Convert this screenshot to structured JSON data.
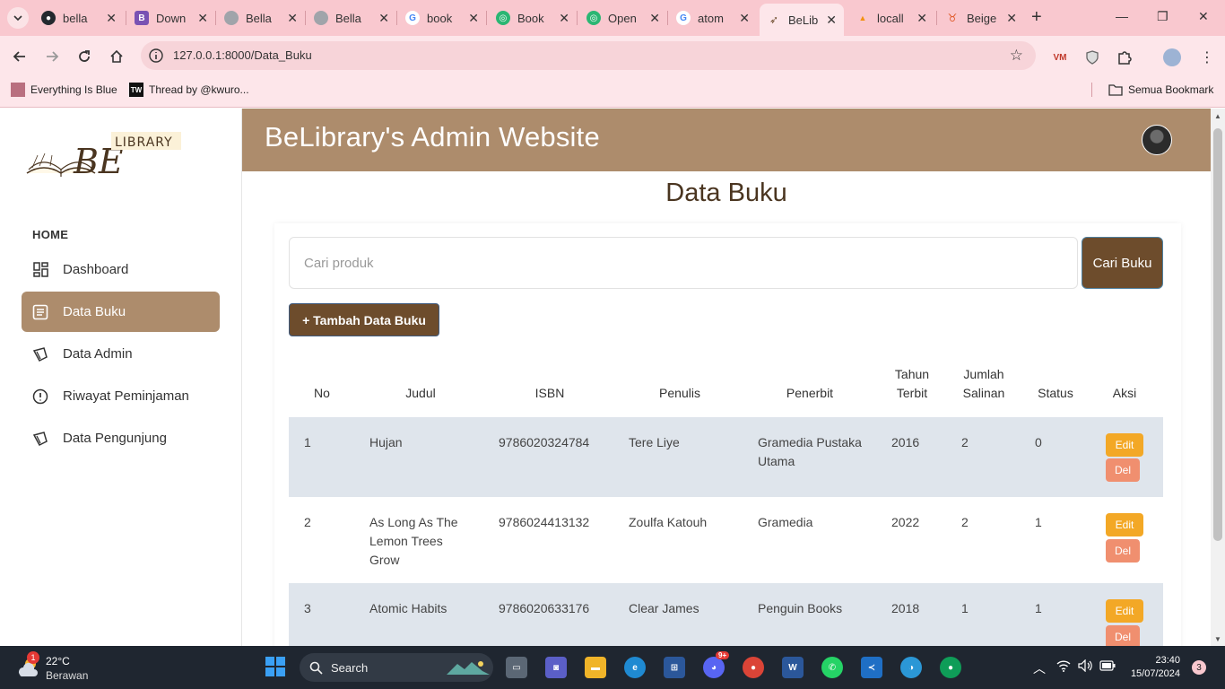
{
  "browser": {
    "tabs": [
      {
        "label": "bella",
        "icon": "github-icon",
        "color": "#333333"
      },
      {
        "label": "Down",
        "icon": "bootstrap-icon",
        "color": "#7952b3"
      },
      {
        "label": "Bella",
        "icon": "globe-icon",
        "color": "#9aa0a6"
      },
      {
        "label": "Bella",
        "icon": "globe-icon",
        "color": "#9aa0a6"
      },
      {
        "label": "book",
        "icon": "google-icon",
        "color": "#4285f4"
      },
      {
        "label": "Book",
        "icon": "openai-icon",
        "color": "#10a37f"
      },
      {
        "label": "Open",
        "icon": "openai-icon",
        "color": "#10a37f"
      },
      {
        "label": "atom",
        "icon": "google-icon",
        "color": "#4285f4"
      },
      {
        "label": "BeLib",
        "icon": "book-icon",
        "color": "#ad8c6c"
      },
      {
        "label": "locall",
        "icon": "phpmyadmin-icon",
        "color": "#f29111"
      },
      {
        "label": "Beige",
        "icon": "tailwind-icon",
        "color": "#f29111"
      }
    ],
    "url": "127.0.0.1:8000/Data_Buku",
    "bookmarks": [
      {
        "label": "Everything Is Blue"
      },
      {
        "label": "Thread by @kwuro..."
      }
    ],
    "all_bookmarks_label": "Semua Bookmark"
  },
  "sidebar": {
    "logo_text": "BE LIBRARY",
    "section_label": "HOME",
    "items": [
      {
        "label": "Dashboard",
        "icon": "dashboard-icon",
        "active": false
      },
      {
        "label": "Data Buku",
        "icon": "document-icon",
        "active": true
      },
      {
        "label": "Data Admin",
        "icon": "ticket-icon",
        "active": false
      },
      {
        "label": "Riwayat Peminjaman",
        "icon": "alert-circle-icon",
        "active": false
      },
      {
        "label": "Data Pengunjung",
        "icon": "ticket-icon",
        "active": false
      }
    ]
  },
  "header": {
    "title": "BeLibrary's Admin Website"
  },
  "main": {
    "page_title": "Data Buku",
    "search_placeholder": "Cari produk",
    "search_button": "Cari Buku",
    "add_button": "+ Tambah Data Buku"
  },
  "table": {
    "columns": [
      "No",
      "Judul",
      "ISBN",
      "Penulis",
      "Penerbit",
      "Tahun Terbit",
      "Jumlah Salinan",
      "Status",
      "Aksi"
    ],
    "rows": [
      {
        "no": "1",
        "judul": "Hujan",
        "isbn": "9786020324784",
        "penulis": "Tere Liye",
        "penerbit": "Gramedia Pustaka Utama",
        "tahun": "2016",
        "jumlah": "2",
        "status": "0"
      },
      {
        "no": "2",
        "judul": "As Long As The Lemon Trees Grow",
        "isbn": "9786024413132",
        "penulis": "Zoulfa Katouh",
        "penerbit": "Gramedia",
        "tahun": "2022",
        "jumlah": "2",
        "status": "1"
      },
      {
        "no": "3",
        "judul": "Atomic Habits",
        "isbn": "9786020633176",
        "penulis": "Clear James",
        "penerbit": "Penguin Books",
        "tahun": "2018",
        "jumlah": "1",
        "status": "1"
      }
    ],
    "edit_label": "Edit",
    "delete_label": "Del"
  },
  "taskbar": {
    "weather_temp": "22°C",
    "weather_status": "Berawan",
    "weather_badge": "1",
    "search_label": "Search",
    "discord_badge": "9+",
    "time": "23:40",
    "date": "15/07/2024",
    "notification_count": "3"
  },
  "colors": {
    "brown_header": "#ad8c6c",
    "dark_brown_button": "#6d4c2c",
    "edit_button": "#f3a826",
    "delete_button": "#f08f6f",
    "row_shade": "#dfe5ec"
  }
}
